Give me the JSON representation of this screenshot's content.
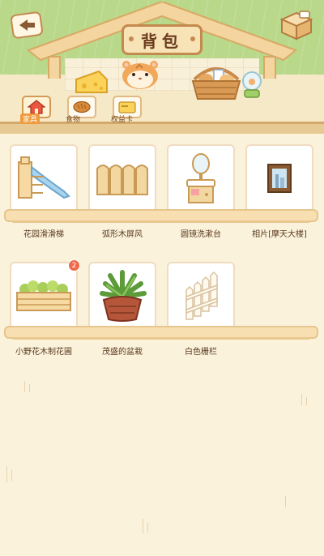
{
  "header": {
    "title": "背包"
  },
  "tabs": [
    {
      "label": "家具",
      "active": true,
      "icon": "house-icon"
    },
    {
      "label": "食物",
      "active": false,
      "icon": "bread-icon"
    },
    {
      "label": "权益卡",
      "active": false,
      "icon": "card-icon"
    }
  ],
  "items": [
    {
      "name": "花园滑滑梯",
      "icon": "slide-icon"
    },
    {
      "name": "弧形木屏风",
      "icon": "screen-icon"
    },
    {
      "name": "圆镜洗漱台",
      "icon": "vanity-icon"
    },
    {
      "name": "相片[摩天大楼]",
      "icon": "photo-frame-icon"
    },
    {
      "name": "小野花木制花圃",
      "icon": "flower-bed-icon",
      "badge": "2"
    },
    {
      "name": "茂盛的盆栽",
      "icon": "potted-plant-icon"
    },
    {
      "name": "白色栅栏",
      "icon": "fence-icon"
    }
  ],
  "colors": {
    "background": "#fbf2dc",
    "grass": "#b9d88a",
    "accent": "#f09a3a",
    "badge": "#ee6a4a"
  }
}
